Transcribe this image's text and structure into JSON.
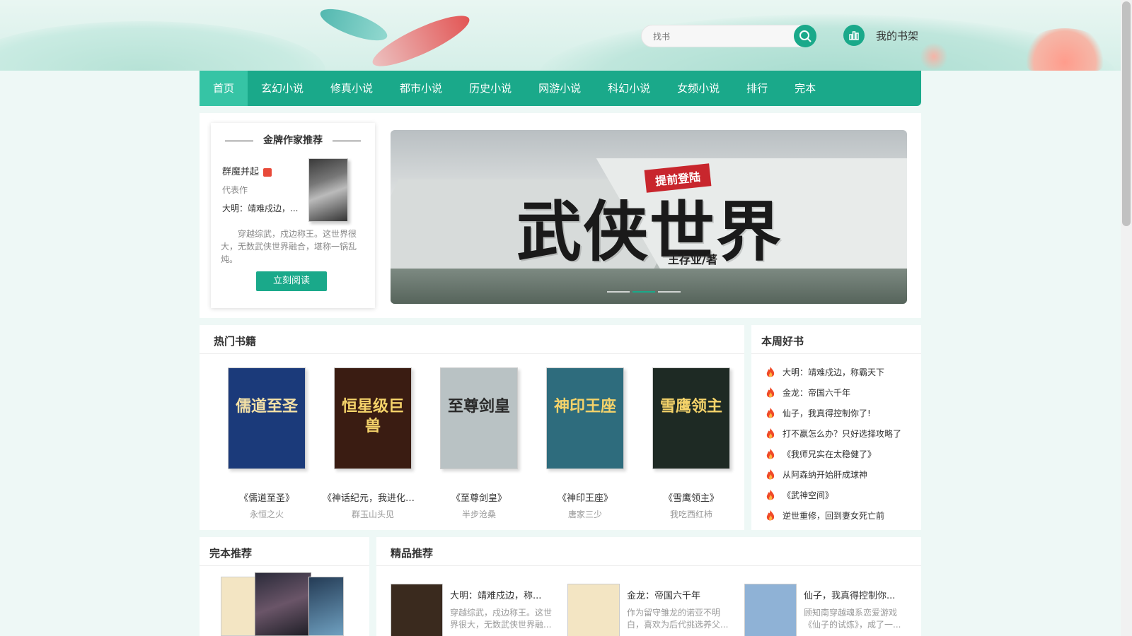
{
  "header": {
    "search_placeholder": "找书",
    "bookshelf_label": "我的书架"
  },
  "nav": {
    "items": [
      "首页",
      "玄幻小说",
      "修真小说",
      "都市小说",
      "历史小说",
      "网游小说",
      "科幻小说",
      "女频小说",
      "排行",
      "完本"
    ],
    "active_index": 0
  },
  "author_card": {
    "title": "金牌作家推荐",
    "author": "群魔并起",
    "rep_label": "代表作",
    "book": "大明：靖难戍边，...",
    "desc": "穿越综武，戍边称王。这世界很大，无数武侠世界融合，堪称一锅乱炖。",
    "button": "立刻阅读"
  },
  "banner": {
    "tag": "提前登陆",
    "title": "武侠世界",
    "author": "王存业/著",
    "dots": 3,
    "active_dot": 1
  },
  "hot": {
    "title": "热门书籍",
    "books": [
      {
        "name": "《儒道至圣》",
        "author": "永恒之火",
        "cover_text": "儒道至圣",
        "cover_color": "#1b3a7a"
      },
      {
        "name": "《神话纪元，我进化成...",
        "author": "群玉山头见",
        "cover_text": "恒星级巨兽",
        "cover_color": "#3a1c12"
      },
      {
        "name": "《至尊剑皇》",
        "author": "半步沧桑",
        "cover_text": "至尊剑皇",
        "cover_color": "#b9c2c4"
      },
      {
        "name": "《神印王座》",
        "author": "唐家三少",
        "cover_text": "神印王座",
        "cover_color": "#2e6c7d"
      },
      {
        "name": "《雪鹰领主》",
        "author": "我吃西红柿",
        "cover_text": "雪鹰领主",
        "cover_color": "#1e2a24"
      }
    ]
  },
  "weekly": {
    "title": "本周好书",
    "items": [
      "大明：靖难戍边，称霸天下",
      "金龙：帝国六千年",
      "仙子，我真得控制你了!",
      "打不赢怎么办？只好选择攻略了",
      "《我师兄实在太稳健了》",
      "从阿森纳开始肝成球神",
      "《武神空间》",
      "逆世重修，回到妻女死亡前"
    ]
  },
  "complete": {
    "title": "完本推荐"
  },
  "premium": {
    "title": "精品推荐",
    "items": [
      {
        "name": "大明：靖难戍边，称...",
        "desc": "穿越综武，戍边称王。这世界很大，无数武侠世界融...",
        "cover_color": "#3a2a1e"
      },
      {
        "name": "金龙：帝国六千年",
        "desc": "作为留守雏龙的诺亚不明白，喜欢为后代挑选养父...",
        "cover_color": "#f3e5c3"
      },
      {
        "name": "仙子，我真得控制你...",
        "desc": "顾知南穿越魂系恋爱游戏《仙子的试炼》，成了一...",
        "cover_color": "#8fb2d6"
      }
    ]
  },
  "colors": {
    "accent": "#1aa98a",
    "nav_active": "#36c4a5"
  }
}
